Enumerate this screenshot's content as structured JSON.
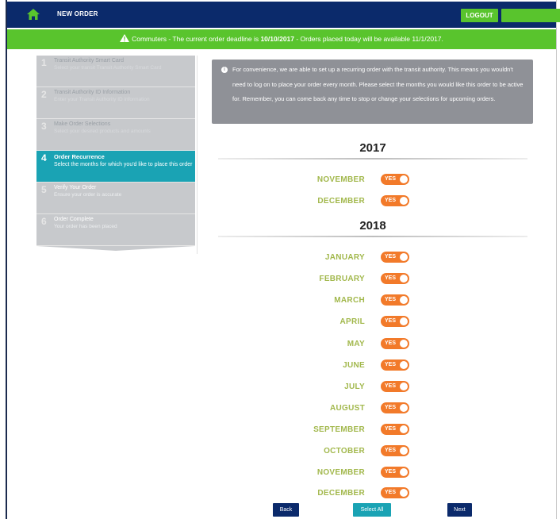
{
  "header": {
    "title": "NEW ORDER",
    "logout_label": "LOGOUT",
    "home_icon": "home-icon"
  },
  "notice": {
    "prefix": "Commuters - The current order deadline is ",
    "deadline": "10/10/2017",
    "suffix": " - Orders placed today will be available 11/1/2017."
  },
  "steps": [
    {
      "num": "1",
      "title": "Transit Authority Smart Card",
      "desc": "Select your transit Transit Authority Smart Card"
    },
    {
      "num": "2",
      "title": "Transit Authority ID Information",
      "desc": "Enter your Transit Authority ID information"
    },
    {
      "num": "3",
      "title": "Make Order Selections",
      "desc": "Select your desired products and amounts"
    },
    {
      "num": "4",
      "title": "Order Recurrence",
      "desc": "Select the months for which you'd like to place this order"
    },
    {
      "num": "5",
      "title": "Verify Your Order",
      "desc": "Ensure your order is accurate"
    },
    {
      "num": "6",
      "title": "Order Complete",
      "desc": "Your order has been placed"
    }
  ],
  "info": {
    "text": "For convenience, we are able to set up a recurring order with the transit authority. This means you wouldn't need to log on to place your order every month. Please select the months you would like this order to be active for. Remember, you can come back any time to stop or change your selections for upcoming orders."
  },
  "years": [
    {
      "year": "2017",
      "months": [
        "NOVEMBER",
        "DECEMBER"
      ]
    },
    {
      "year": "2018",
      "months": [
        "JANUARY",
        "FEBRUARY",
        "MARCH",
        "APRIL",
        "MAY",
        "JUNE",
        "JULY",
        "AUGUST",
        "SEPTEMBER",
        "OCTOBER",
        "NOVEMBER",
        "DECEMBER"
      ]
    }
  ],
  "toggle_label": "YES",
  "buttons": {
    "back": "Back",
    "select_all": "Select All",
    "next": "Next"
  },
  "colors": {
    "navy": "#0b2a6b",
    "green": "#59c42d",
    "teal": "#1aa3b4",
    "orange": "#f27a2a",
    "month_text": "#a2b84c"
  }
}
